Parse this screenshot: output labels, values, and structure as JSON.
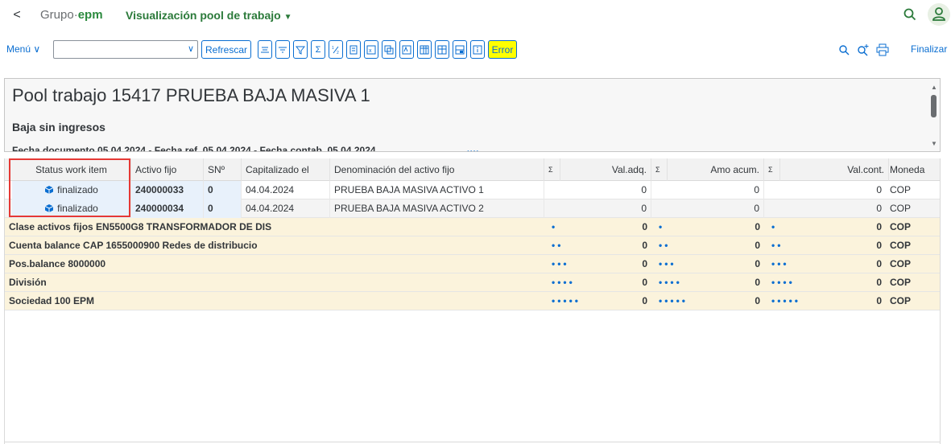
{
  "shell": {
    "back_glyph": "<",
    "brand_prefix": "Grupo·",
    "brand_epm": "epm",
    "app_title": "Visualización pool de trabajo",
    "title_caret": "▼"
  },
  "toolbar": {
    "menu_label": "Menú ∨",
    "combo_value": "",
    "combo_dropdown": "∨",
    "refresh_label": "Refrescar",
    "error_label": "Error",
    "finalize_label": "Finalizar"
  },
  "header": {
    "pool_title": "Pool trabajo 15417 PRUEBA BAJA MASIVA 1",
    "subtitle": "Baja sin ingresos",
    "dates": "Fecha documento 05.04.2024 - Fecha ref. 05.04.2024 - Fecha contab. 05.04.2024",
    "resize_handle": "••••"
  },
  "table": {
    "columns": {
      "status": "Status work item",
      "asset": "Activo fijo",
      "sn": "SNº",
      "capitalized": "Capitalizado el",
      "description": "Denominación del activo fijo",
      "sum1": "Σ",
      "acq_value": "Val.adq.",
      "sum2": "Σ",
      "accum_dep": "Amo acum.",
      "sum3": "Σ",
      "book_value": "Val.cont.",
      "currency": "Moneda"
    },
    "rows": [
      {
        "status": "finalizado",
        "asset": "240000033",
        "sn": "0",
        "capitalized": "04.04.2024",
        "description": "PRUEBA BAJA MASIVA ACTIVO 1",
        "acq_value": "0",
        "accum_dep": "0",
        "book_value": "0",
        "currency": "COP"
      },
      {
        "status": "finalizado",
        "asset": "240000034",
        "sn": "0",
        "capitalized": "04.04.2024",
        "description": "PRUEBA BAJA MASIVA ACTIVO 2",
        "acq_value": "0",
        "accum_dep": "0",
        "book_value": "0",
        "currency": "COP"
      }
    ],
    "subtotals": [
      {
        "label": "Clase activos fijos EN5500G8 TRANSFORMADOR DE DIS",
        "dots": "•",
        "acq_value": "0",
        "accum_dep": "0",
        "book_value": "0",
        "currency": "COP"
      },
      {
        "label": "Cuenta balance CAP 1655000900 Redes de distribucio",
        "dots": "••",
        "acq_value": "0",
        "accum_dep": "0",
        "book_value": "0",
        "currency": "COP"
      },
      {
        "label": "Pos.balance 8000000",
        "dots": "•••",
        "acq_value": "0",
        "accum_dep": "0",
        "book_value": "0",
        "currency": "COP"
      },
      {
        "label": "División",
        "dots": "••••",
        "acq_value": "0",
        "accum_dep": "0",
        "book_value": "0",
        "currency": "COP"
      },
      {
        "label": "Sociedad 100 EPM",
        "dots": "•••••",
        "acq_value": "0",
        "accum_dep": "0",
        "book_value": "0",
        "currency": "COP"
      }
    ]
  },
  "colors": {
    "accent": "#0a6ed1",
    "brand_green": "#2b7a3a",
    "error_highlight": "#ffff00",
    "subtotal_bg": "#fbf3dc",
    "annotation_red": "#e53935"
  },
  "icons": [
    "chevron-left-icon",
    "search-icon",
    "user-icon",
    "zoom-in-icon",
    "print-icon",
    "status-cube-icon"
  ]
}
